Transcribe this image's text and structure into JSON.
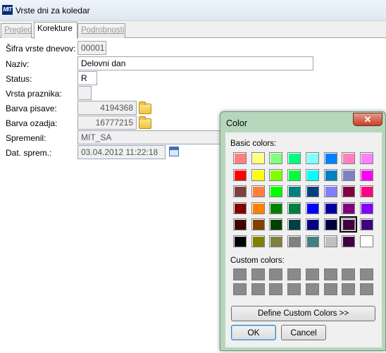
{
  "window": {
    "logo": "MIT",
    "title": "Vrste dni za koledar"
  },
  "tabs": [
    {
      "label": "Pregled"
    },
    {
      "label": "Korekture"
    },
    {
      "label": "Podrobnosti"
    }
  ],
  "form": {
    "sifra": {
      "label": "Šifra vrste dnevov:",
      "value": "00001"
    },
    "naziv": {
      "label": "Naziv:",
      "value": "Delovni dan"
    },
    "status": {
      "label": "Status:",
      "value": "R"
    },
    "praznik": {
      "label": "Vrsta praznika:",
      "value": ""
    },
    "pisava": {
      "label": "Barva pisave:",
      "value": "4194368"
    },
    "ozadje": {
      "label": "Barva ozadja:",
      "value": "16777215"
    },
    "spremenil": {
      "label": "Spremenil:",
      "value": "MIT_SA"
    },
    "datum": {
      "label": "Dat. sprem.:",
      "value": "03.04.2012 11:22:18"
    }
  },
  "dialog": {
    "title": "Color",
    "close": "✕",
    "basic_label": "Basic colors:",
    "custom_label": "Custom colors:",
    "define_button": "Define Custom Colors >>",
    "ok_button": "OK",
    "cancel_button": "Cancel",
    "basic_colors": [
      "#ff8080",
      "#ffff80",
      "#80ff80",
      "#00ff80",
      "#80ffff",
      "#0080ff",
      "#ff80c0",
      "#ff80ff",
      "#ff0000",
      "#ffff00",
      "#80ff00",
      "#00ff40",
      "#00ffff",
      "#0080c0",
      "#8080c0",
      "#ff00ff",
      "#804040",
      "#ff8040",
      "#00ff00",
      "#008080",
      "#004080",
      "#8080ff",
      "#800040",
      "#ff0080",
      "#800000",
      "#ff8000",
      "#008000",
      "#008040",
      "#0000ff",
      "#0000a0",
      "#800080",
      "#8000ff",
      "#400000",
      "#804000",
      "#004000",
      "#004040",
      "#000080",
      "#000040",
      "#400040",
      "#400080",
      "#000000",
      "#808000",
      "#808040",
      "#808080",
      "#408080",
      "#c0c0c0",
      "#400040",
      "#ffffff"
    ],
    "selected_index": 38
  }
}
